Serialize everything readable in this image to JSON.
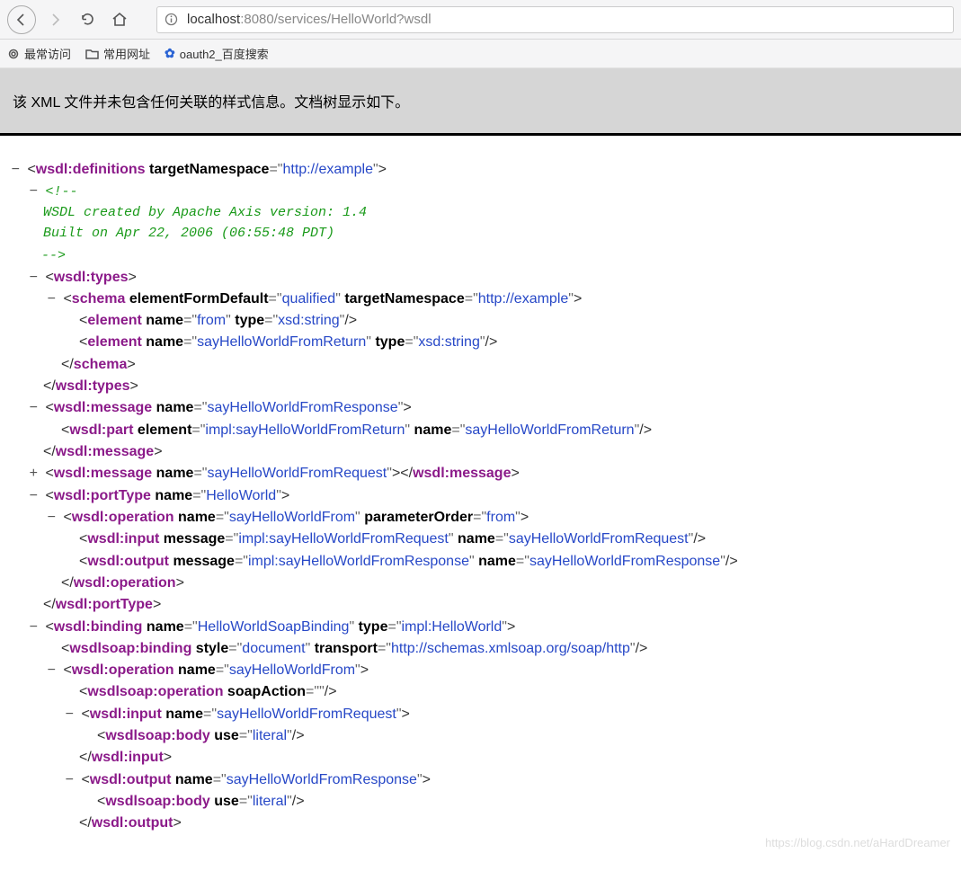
{
  "url_host": "localhost",
  "url_port": ":8080",
  "url_path": "/services/HelloWorld?wsdl",
  "bookmarks": {
    "most_visited": "最常访问",
    "common_sites": "常用网址",
    "oauth2": "oauth2_百度搜索"
  },
  "banner": "该 XML 文件并未包含任何关联的样式信息。文档树显示如下。",
  "xml": {
    "root_tag": "wsdl:definitions",
    "root_attr_name": "targetNamespace",
    "root_attr_val": "http://example",
    "comment_open": "<!--",
    "comment_l1": "WSDL created by Apache Axis version: 1.4",
    "comment_l2": "Built on Apr 22, 2006 (06:55:48 PDT)",
    "comment_close": "-->",
    "types_tag": "wsdl:types",
    "schema_tag": "schema",
    "schema_efd_name": "elementFormDefault",
    "schema_efd_val": "qualified",
    "schema_tn_name": "targetNamespace",
    "schema_tn_val": "http://example",
    "element_tag": "element",
    "el1_name_val": "from",
    "el1_type_val": "xsd:string",
    "el2_name_val": "sayHelloWorldFromReturn",
    "el2_type_val": "xsd:string",
    "msg_tag": "wsdl:message",
    "msg1_name_val": "sayHelloWorldFromResponse",
    "part_tag": "wsdl:part",
    "part_el_val": "impl:sayHelloWorldFromReturn",
    "part_name_val": "sayHelloWorldFromReturn",
    "msg2_name_val": "sayHelloWorldFromRequest",
    "porttype_tag": "wsdl:portType",
    "porttype_name_val": "HelloWorld",
    "op_tag": "wsdl:operation",
    "op_name_val": "sayHelloWorldFrom",
    "op_po_name": "parameterOrder",
    "op_po_val": "from",
    "input_tag": "wsdl:input",
    "input_msg_val": "impl:sayHelloWorldFromRequest",
    "input_name_val": "sayHelloWorldFromRequest",
    "output_tag": "wsdl:output",
    "output_msg_val": "impl:sayHelloWorldFromResponse",
    "output_name_val": "sayHelloWorldFromResponse",
    "binding_tag": "wsdl:binding",
    "binding_name_val": "HelloWorldSoapBinding",
    "binding_type_val": "impl:HelloWorld",
    "soapbind_tag": "wsdlsoap:binding",
    "soapbind_style_val": "document",
    "soapbind_trans_val": "http://schemas.xmlsoap.org/soap/http",
    "soapop_tag": "wsdlsoap:operation",
    "soapop_action_name": "soapAction",
    "soapop_action_val": "",
    "soapbody_tag": "wsdlsoap:body",
    "soapbody_use_val": "literal",
    "attr_name": "name",
    "attr_type": "type",
    "attr_element": "element",
    "attr_message": "message",
    "attr_style": "style",
    "attr_transport": "transport",
    "attr_use": "use"
  },
  "watermark": "https://blog.csdn.net/aHardDreamer"
}
